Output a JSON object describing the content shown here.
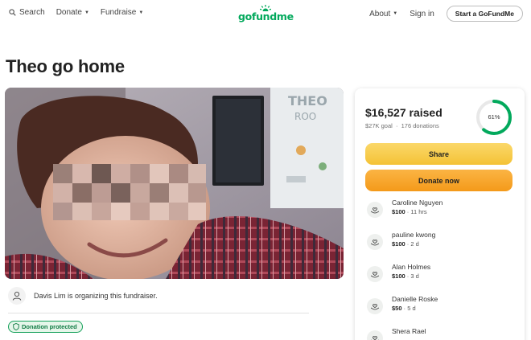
{
  "header": {
    "search_label": "Search",
    "donate_label": "Donate",
    "fundraise_label": "Fundraise",
    "logo_text": "gofundme",
    "about_label": "About",
    "signin_label": "Sign in",
    "start_label": "Start a GoFundMe"
  },
  "campaign": {
    "title": "Theo go home",
    "organizer_text": "Davis Lim is organizing this fundraiser.",
    "protected_label": "Donation protected"
  },
  "stats": {
    "raised": "$16,527 raised",
    "goal": "$27K goal",
    "donations": "176 donations",
    "percent_label": "61%",
    "progress_fraction": 0.61
  },
  "actions": {
    "share_label": "Share",
    "donate_label": "Donate now"
  },
  "donors": [
    {
      "name": "Caroline Nguyen",
      "amount": "$100",
      "time": "11 hrs"
    },
    {
      "name": "pauline kwong",
      "amount": "$100",
      "time": "2 d"
    },
    {
      "name": "Alan Holmes",
      "amount": "$100",
      "time": "3 d"
    },
    {
      "name": "Danielle Roske",
      "amount": "$50",
      "time": "5 d"
    },
    {
      "name": "Shera Rael",
      "amount": "",
      "time": ""
    }
  ],
  "colors": {
    "brand": "#02a95c",
    "share_button": "#f4c235",
    "donate_button": "#f49a1a",
    "protected_badge": "#15a05a"
  },
  "icons": {
    "search": "magnifier-icon",
    "organizer": "person-icon",
    "protected": "shield-icon",
    "donor": "heart-hands-icon"
  }
}
